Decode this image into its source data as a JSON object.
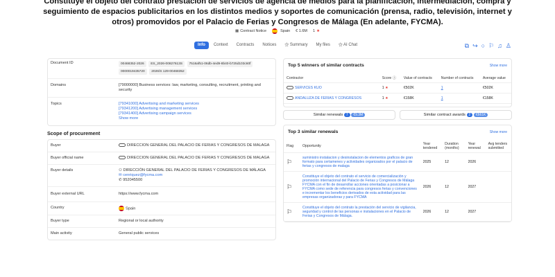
{
  "header": {
    "title": "Constituye el objeto del contrato prestación de servicios de agencia de medios para la planificación, intermediación, compra y seguimiento de espacios publicitarios en los distintos medios y soportes de comunicación (prensa, radio, televisión, internet y otros) promovidos por el Palacio de Ferias y Congresos de Málaga (En adelante, FYCMA).",
    "notice_type": "Contract Notice",
    "country": "Spain",
    "value": "€ 1.6M",
    "score": "1"
  },
  "tabs": [
    "Info",
    "Context",
    "Contracts",
    "Notices",
    "Summary",
    "My files",
    "AI Chat"
  ],
  "document": {
    "id_label": "Document ID",
    "ids": [
      "00468352-2026",
      "ES_2026-00827613S",
      "7516af51-06db-4ed9-8b40-b725d103c60f",
      "0000019435720",
      "2026/S 129-00468352"
    ],
    "domains_label": "Domains",
    "domains": "[79000000] Business services: law, marketing, consulting, recruitment, printing and security",
    "topics_label": "Topics",
    "topics": [
      "[79341000] Advertising and marketing services",
      "[79341200] Advertising management services",
      "[79341400] Advertising campaign services"
    ],
    "show_more": "Show more"
  },
  "scope": {
    "heading": "Scope of procurement",
    "buyer_label": "Buyer",
    "buyer": "DIRECCION GENERAL DEL PALACIO DE FERIAS Y CONGRESOS DE MALAGA",
    "official_label": "Buyer official name",
    "official": "DIRECCION GENERAL DEL PALACIO DE FERIAS Y CONGRESOS DE MALAGA",
    "details_label": "Buyer details",
    "details_name": "DIRECCIÓN GENERAL DEL PALACIO DE FERIAS Y CONGRESOS DE MÁLAGA",
    "details_email": "cenriquez@fycma.com",
    "details_phone": "952045500",
    "url_label": "Buyer external URL",
    "url": "https://www.fycma.com",
    "country_label": "Country",
    "country": "Spain",
    "type_label": "Buyer type",
    "type": "Regional or local authority",
    "activity_label": "Main activity",
    "activity": "General public services"
  },
  "winners": {
    "title": "Top 5 winners of similar contracts",
    "show_more": "Show more",
    "cols": [
      "Contractor",
      "Score",
      "Value of contracts",
      "Number of contracts",
      "Average value"
    ],
    "rows": [
      {
        "name": "SERVICES KUO",
        "score": "1",
        "value": "€502K",
        "count": "1",
        "avg": "€502K"
      },
      {
        "name": "ANDALUZA DE FERIAS Y CONGRESOS",
        "score": "1",
        "value": "€158K",
        "count": "1",
        "avg": "€158K"
      }
    ],
    "renewals_label": "Similar renewals",
    "renewals_count": "7",
    "renewals_amount": "€9.3M",
    "awards_label": "Similar contract awards",
    "awards_count": "2",
    "awards_amount": "€661K"
  },
  "renewals": {
    "title": "Top 3 similar renewals",
    "show_more": "Show more",
    "cols": [
      "Flag",
      "Opportunity",
      "Year tendered",
      "Duration (months)",
      "Year renewal",
      "Avg tenders submitted"
    ],
    "rows": [
      {
        "opp": "suministro instalacion y desinstalacion de elementos graficos de gran formato para certamenes y actividades organizados por el palacio de ferias y congresos de malaga",
        "year": "2025",
        "dur": "12",
        "renew": "2026",
        "avg": ""
      },
      {
        "opp": "Constituye el objeto del contrato el servicio de comercialización y promoción internacional del Palacio de Ferias y Congresos de Málaga FYCMA con el fin de desarrollar acciones orientadas a posicionar a FYCMA como sede de referencia para congresos ferias y convenciones e incrementar los beneficios derivados de esta actividad para las empresas organizadoras y para FYCMA",
        "year": "2026",
        "dur": "12",
        "renew": "2027",
        "avg": ""
      },
      {
        "opp": "Constituye el objeto del contrato la prestación del servicio de vigilancia, seguridad y control de las personas e instalaciones en el Palacio de Ferias y Congresos de Málaga.",
        "year": "2026",
        "dur": "12",
        "renew": "2027",
        "avg": ""
      }
    ]
  }
}
